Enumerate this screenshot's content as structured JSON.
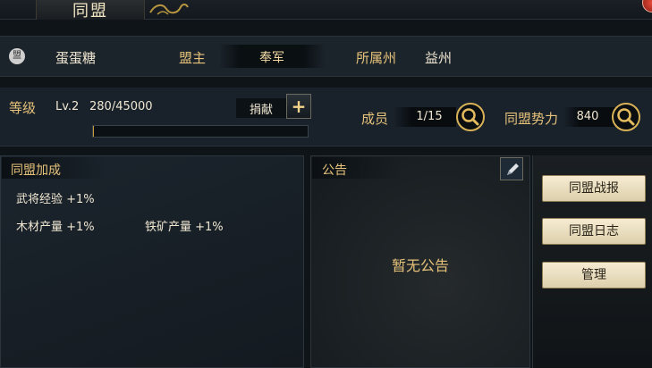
{
  "window": {
    "title": "同盟"
  },
  "header": {
    "emblem_text": "盟",
    "alliance_name": "蛋蛋糖",
    "leader_label": "盟主",
    "leader_value": "奉军",
    "state_label": "所属州",
    "state_value": "益州"
  },
  "level": {
    "label": "等级",
    "level_value": "Lv.2",
    "exp_text": "280/45000",
    "exp_progress": 0.006,
    "donate_label": "捐献",
    "donate_plus": "+"
  },
  "stats": {
    "members_label": "成员",
    "members_value": "1/15",
    "power_label": "同盟势力",
    "power_value": "840"
  },
  "bonus": {
    "title": "同盟加成",
    "items": [
      "武将经验 +1%",
      "木材产量 +1%",
      "铁矿产量 +1%"
    ]
  },
  "notice": {
    "title": "公告",
    "empty_text": "暂无公告"
  },
  "side_buttons": {
    "battle_report": "同盟战报",
    "log": "同盟日志",
    "manage": "管理"
  },
  "colors": {
    "accent_gold": "#e6c27a",
    "button_face": "#f6ecd2",
    "close_red": "#e84a3a"
  },
  "icons": [
    "search-icon",
    "edit-icon",
    "plus-icon",
    "close-icon",
    "ornament-icon"
  ]
}
